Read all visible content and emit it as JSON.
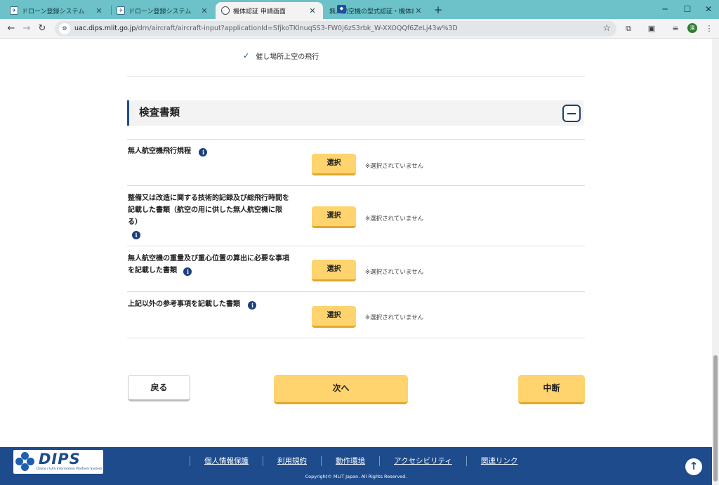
{
  "browser": {
    "tabs": [
      {
        "title": "ドローン登録システム",
        "active": false,
        "favicon": "drone-icon"
      },
      {
        "title": "ドローン登録システム",
        "active": false,
        "favicon": "drone-icon"
      },
      {
        "title": "機体認証 申請画面",
        "active": true,
        "favicon": "globe-icon"
      },
      {
        "title": "無人航空機の型式認証・機体認証",
        "active": false,
        "favicon": "mlit-logo-icon"
      }
    ],
    "url_host": "uac.dips.mlit.go.jp",
    "url_path": "/drn/aircraft/aircraft-input?applicationId=SfjkoTKlnuqSS3-FW0j6zS3rbk_W-XXOQQf6ZeLj43w%3D",
    "profile_initial": "濱"
  },
  "page": {
    "prev_item": "催し場所上空の飛行",
    "section_title": "検査書類",
    "select_label": "選択",
    "not_selected": "※選択されていません",
    "documents": [
      {
        "label": "無人航空機飛行規程"
      },
      {
        "label": "整備又は改造に関する技術的記録及び総飛行時間を記載した書類（航空の用に供した無人航空機に限る）"
      },
      {
        "label": "無人航空機の重量及び重心位置の算出に必要な事項を記載した書類"
      },
      {
        "label": "上記以外の参考事項を記載した書類"
      }
    ],
    "buttons": {
      "back": "戻る",
      "next": "次へ",
      "suspend": "中断"
    }
  },
  "footer": {
    "logo_text": "DIPS",
    "logo_subtext": "Drone / UAS Information Platform System",
    "links": [
      "個人情報保護",
      "利用規約",
      "動作環境",
      "アクセシビリティ",
      "関連リンク"
    ],
    "copyright": "Copyright© MLIT Japan. All Rights Reserved."
  },
  "colors": {
    "accent_yellow": "#ffd36e",
    "brand_blue": "#1d4b8b",
    "tabstrip": "#6cc2c8"
  }
}
